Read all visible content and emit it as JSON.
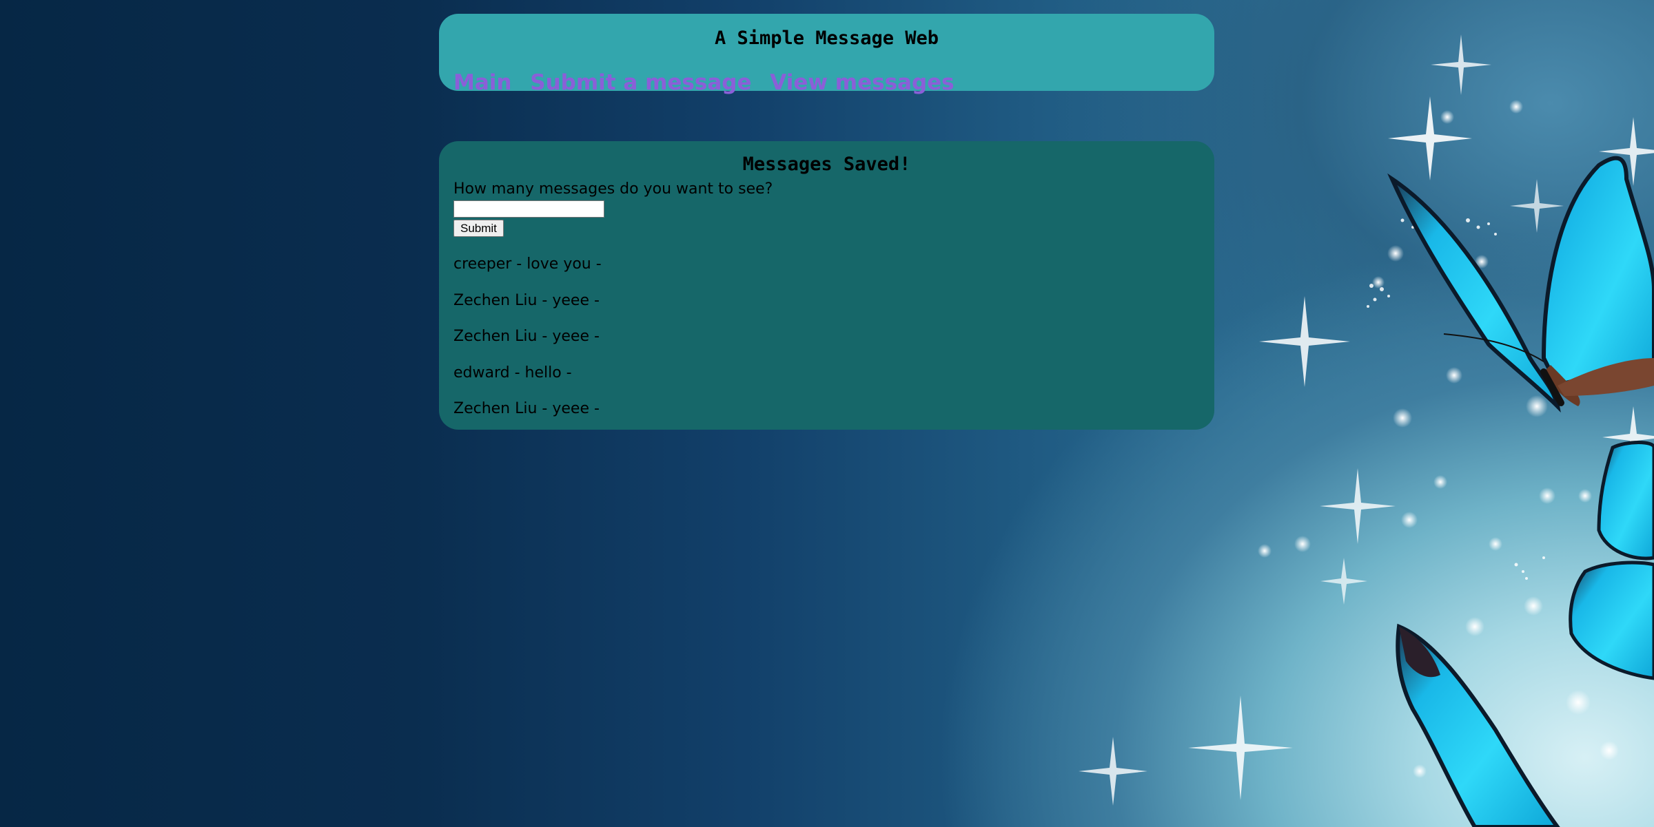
{
  "header": {
    "title": "A Simple Message Web",
    "nav": [
      {
        "label": "Main"
      },
      {
        "label": "Submit a message"
      },
      {
        "label": "View messages"
      }
    ]
  },
  "main": {
    "title": "Messages Saved!",
    "form": {
      "label": "How many messages do you want to see?",
      "input_value": "",
      "submit_label": "Submit"
    },
    "messages": [
      "creeper - love you -",
      "Zechen Liu - yeee -",
      "Zechen Liu - yeee -",
      "edward - hello -",
      "Zechen Liu - yeee -"
    ]
  },
  "colors": {
    "header_panel": "#33a6ad",
    "main_panel": "#166769",
    "nav_link": "#8b5fd8"
  },
  "decorations": {
    "background": "butterfly-sparkle-wallpaper"
  }
}
